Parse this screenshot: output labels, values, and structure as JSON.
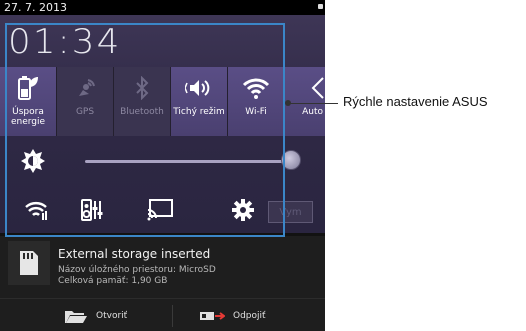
{
  "status": {
    "date": "27. 7. 2013"
  },
  "clock": {
    "time": "01:34"
  },
  "tiles": [
    {
      "label": "Úspora energie",
      "icon": "battery-leaf-icon",
      "state": "on"
    },
    {
      "label": "GPS",
      "icon": "gps-icon",
      "state": "off"
    },
    {
      "label": "Bluetooth",
      "icon": "bluetooth-icon",
      "state": "off"
    },
    {
      "label": "Tichý režim",
      "icon": "speaker-vibrate-icon",
      "state": "on"
    },
    {
      "label": "Wi-Fi",
      "icon": "wifi-icon",
      "state": "on"
    },
    {
      "label": "Auto",
      "icon": "auto-rotate-icon",
      "state": "on"
    }
  ],
  "brightness": {
    "level": 0.98
  },
  "bottom": {
    "vm_label": "Vym"
  },
  "notification": {
    "title": "External storage inserted",
    "line1": "Názov úložného priestoru: MicroSD",
    "line2": "Celková pamäť: 1,90 GB",
    "open_label": "Otvoriť",
    "eject_label": "Odpojiť"
  },
  "callout": {
    "label": "Rýchle nastavenie ASUS"
  },
  "colors": {
    "accent": "#3b86c8",
    "panel": "#2f2945",
    "tile_on": "#5a4e86"
  }
}
